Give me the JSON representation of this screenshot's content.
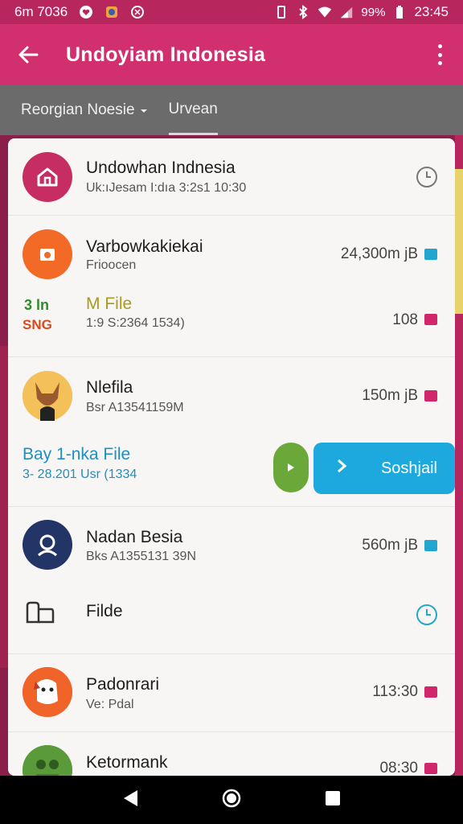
{
  "status_bar": {
    "left_text": "6m 7036",
    "battery_text": "99%",
    "time": "23:45"
  },
  "app_bar": {
    "title": "Undoyiam Indonesia"
  },
  "tabs": [
    {
      "label": "Reorgian Noesie"
    },
    {
      "label": "Urvean"
    }
  ],
  "list": [
    {
      "title": "Undowhan Indnesia",
      "subtitle": "Uk:ıJesam I:dıa 3:2s1 10:30",
      "meta": "",
      "avatar_color": "#c62e63",
      "icon": "home-icon"
    },
    {
      "title": "Varbowkakiekai",
      "subtitle": "Frioocen",
      "meta": "24,300m jB",
      "avatar_color": "#f26a25",
      "icon": "camera-icon",
      "badge_color": "#22a6cf"
    },
    {
      "title": "M File",
      "subtitle": "1:9 S:2364 1534)",
      "meta": "108",
      "prefix_top": "3 ln",
      "prefix_bottom": "SNG",
      "badge_color": "#d2266a"
    },
    {
      "title": "Nlefila",
      "subtitle": "Bsr A13541159M",
      "meta": "150m jB",
      "avatar_color": "#f0b35a",
      "icon": "fox-avatar-icon",
      "badge_color": "#d2266a"
    },
    {
      "title": "Bay 1-nka File",
      "subtitle": "3- 28.201 Usr (1334",
      "action_label": "Soshjail"
    },
    {
      "title": "Nadan Besia",
      "subtitle": "Bks A1355131 39N",
      "meta": "560m jB",
      "avatar_color": "#233566",
      "icon": "user-icon",
      "badge_color": "#22a6cf"
    },
    {
      "title": "Filde",
      "subtitle": "",
      "meta": "",
      "icon": "folder-outline-icon"
    },
    {
      "title": "Padonrari",
      "subtitle": "Ve: Pdal",
      "meta": "113:30",
      "avatar_color": "#f06a2a",
      "icon": "dog-avatar-icon",
      "badge_color": "#d2266a"
    },
    {
      "title": "Ketormank",
      "subtitle": "",
      "meta": "08:30",
      "avatar_color": "#5a9a3a",
      "icon": "frog-avatar-icon",
      "badge_color": "#d2266a"
    }
  ]
}
